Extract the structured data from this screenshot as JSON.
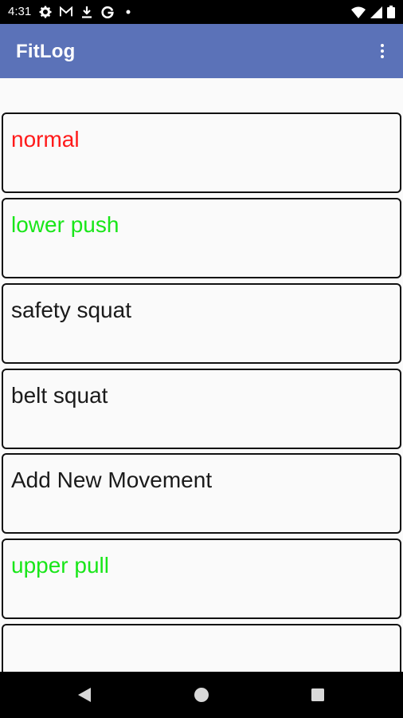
{
  "status_bar": {
    "time": "4:31",
    "left_icons": [
      "gear-icon",
      "gmail-icon",
      "download-icon",
      "google-icon",
      "dot-icon"
    ],
    "right_icons": [
      "wifi-icon",
      "signal-icon",
      "battery-icon"
    ]
  },
  "app_bar": {
    "title": "FitLog",
    "menu_icon": "overflow-menu-icon",
    "color": "#5b72b8"
  },
  "movements": [
    {
      "label": "normal",
      "color": "#ff1a1a"
    },
    {
      "label": "lower push",
      "color": "#19e619"
    },
    {
      "label": "safety squat",
      "color": "#1a1a1a"
    },
    {
      "label": "belt squat",
      "color": "#1a1a1a"
    },
    {
      "label": "Add New Movement",
      "color": "#1a1a1a"
    },
    {
      "label": "upper pull",
      "color": "#19e619"
    },
    {
      "label": "",
      "color": "#1a1a1a"
    }
  ],
  "nav_bar": {
    "buttons": [
      "back-icon",
      "home-icon",
      "recents-icon"
    ]
  }
}
